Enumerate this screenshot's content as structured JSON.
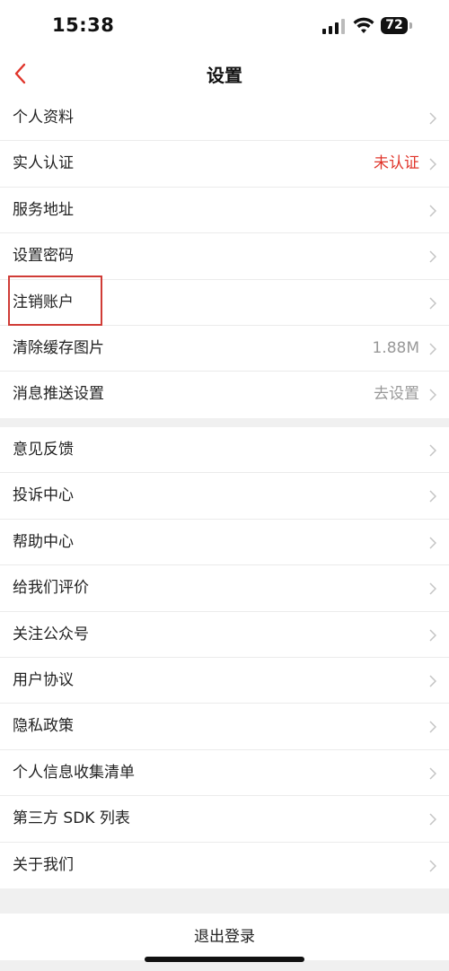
{
  "status_bar": {
    "time": "15:38",
    "battery": "72"
  },
  "nav": {
    "title": "设置"
  },
  "group1": [
    {
      "label": "个人资料",
      "value": ""
    },
    {
      "label": "实人认证",
      "value": "未认证",
      "value_color": "#e0352b"
    },
    {
      "label": "服务地址",
      "value": ""
    },
    {
      "label": "设置密码",
      "value": ""
    },
    {
      "label": "注销账户",
      "value": ""
    },
    {
      "label": "清除缓存图片",
      "value": "1.88M"
    },
    {
      "label": "消息推送设置",
      "value": "去设置"
    }
  ],
  "group2": [
    {
      "label": "意见反馈"
    },
    {
      "label": "投诉中心"
    },
    {
      "label": "帮助中心"
    },
    {
      "label": "给我们评价"
    },
    {
      "label": "关注公众号"
    },
    {
      "label": "用户协议"
    },
    {
      "label": "隐私政策"
    },
    {
      "label": "个人信息收集清单"
    },
    {
      "label": "第三方 SDK 列表"
    },
    {
      "label": "关于我们"
    }
  ],
  "logout": {
    "label": "退出登录"
  },
  "colors": {
    "accent": "#e0352b",
    "highlight_box": "#d03c36"
  }
}
